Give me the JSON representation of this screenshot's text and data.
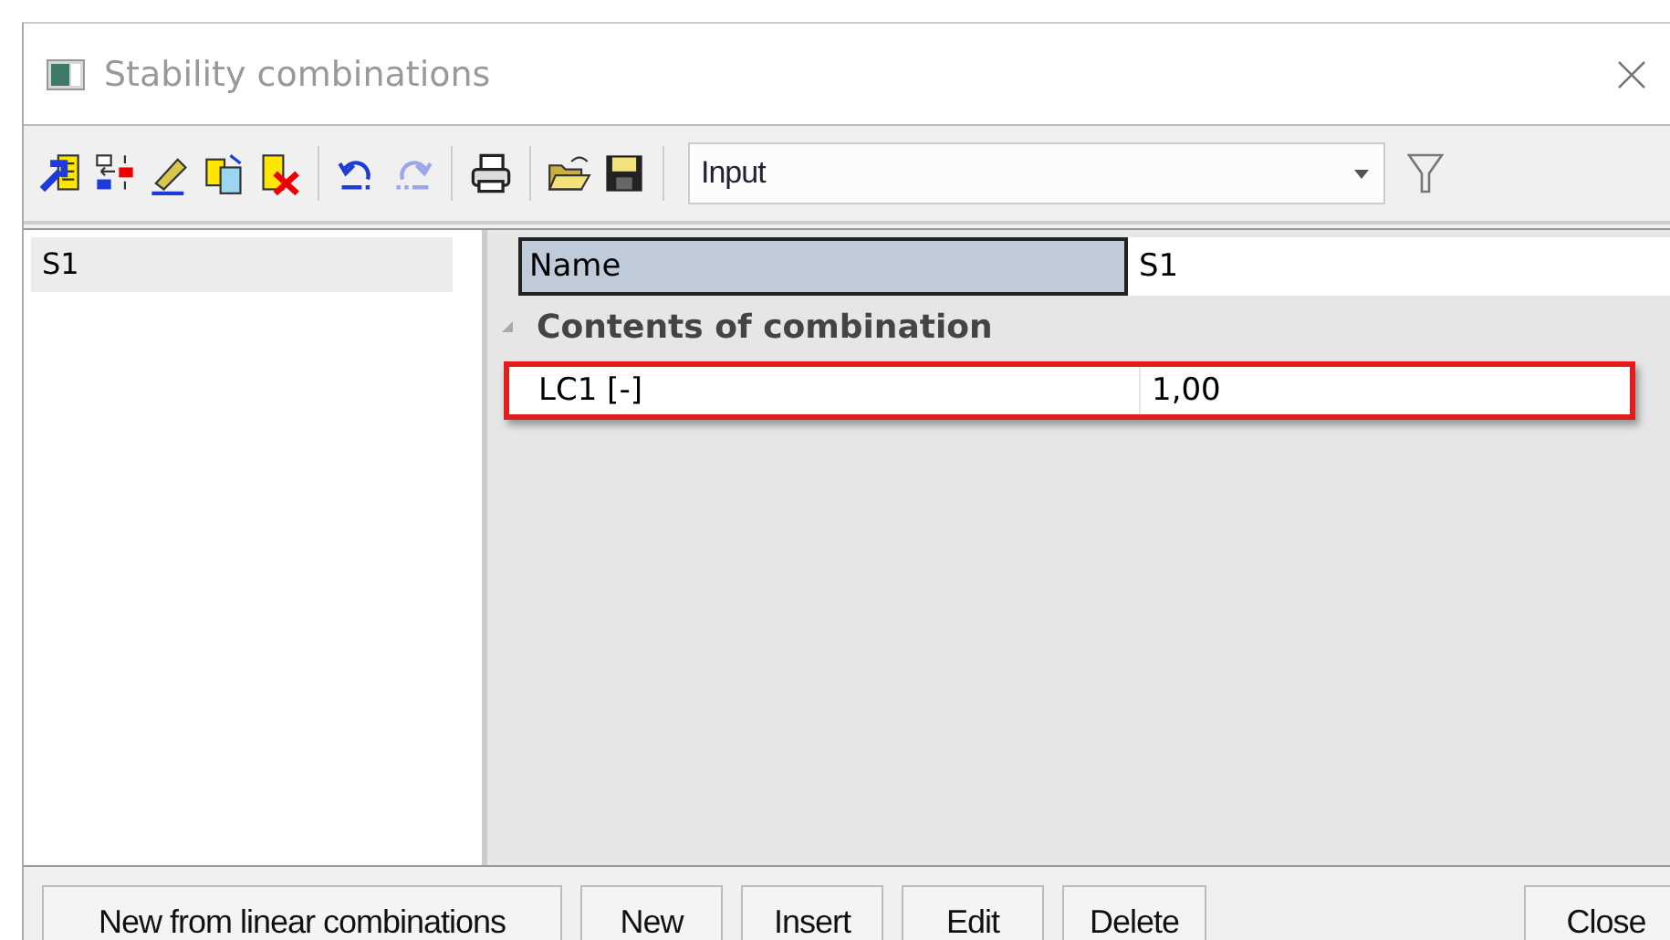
{
  "window": {
    "title": "Stability combinations"
  },
  "toolbar": {
    "tools": [
      {
        "kind": "arrow-table",
        "disabled": false
      },
      {
        "kind": "move",
        "disabled": false
      },
      {
        "kind": "pencil",
        "disabled": false
      },
      {
        "kind": "copy",
        "disabled": false
      },
      {
        "kind": "delete",
        "disabled": false
      },
      {
        "kind": "separator"
      },
      {
        "kind": "undo",
        "disabled": false
      },
      {
        "kind": "redo",
        "disabled": true
      },
      {
        "kind": "separator"
      },
      {
        "kind": "print",
        "disabled": false
      },
      {
        "kind": "separator"
      },
      {
        "kind": "open",
        "disabled": false
      },
      {
        "kind": "save",
        "disabled": false
      },
      {
        "kind": "separator"
      }
    ],
    "view_select": {
      "value": "Input"
    }
  },
  "list": {
    "items": [
      {
        "label": "S1",
        "selected": true
      }
    ]
  },
  "properties": {
    "rows": [
      {
        "label": "Name",
        "value": "S1",
        "selected": true,
        "highlighted": false
      }
    ],
    "categories": [
      {
        "title": "Contents of combination",
        "expanded": true,
        "rows": [
          {
            "label": "LC1 [-]",
            "value": "1,00",
            "selected": false,
            "highlighted": true
          }
        ]
      }
    ]
  },
  "buttons": [
    {
      "label": "New from linear combinations"
    },
    {
      "label": "New"
    },
    {
      "label": "Insert"
    },
    {
      "label": "Edit"
    },
    {
      "label": "Delete"
    }
  ],
  "close_button": {
    "label": "Close"
  }
}
